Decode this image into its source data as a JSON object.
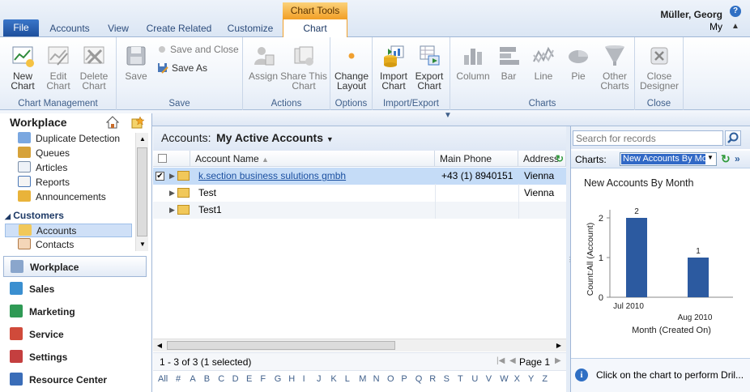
{
  "tabs": {
    "file": "File",
    "accounts": "Accounts",
    "view": "View",
    "create_related": "Create Related",
    "customize": "Customize",
    "chart_tools": "Chart Tools",
    "chart": "Chart"
  },
  "user": {
    "name": "Müller, Georg",
    "org": "My"
  },
  "ribbon": {
    "chart_management": {
      "label": "Chart Management",
      "new_chart": [
        "New",
        "Chart"
      ],
      "edit_chart": [
        "Edit",
        "Chart"
      ],
      "delete_chart": [
        "Delete",
        "Chart"
      ]
    },
    "save": {
      "label": "Save",
      "save": "Save",
      "save_close": "Save and Close",
      "save_as": "Save As"
    },
    "actions": {
      "label": "Actions",
      "assign": "Assign",
      "share": [
        "Share This",
        "Chart"
      ]
    },
    "options": {
      "label": "Options",
      "change_layout": [
        "Change",
        "Layout"
      ]
    },
    "import_export": {
      "label": "Import/Export",
      "import": [
        "Import",
        "Chart"
      ],
      "export": [
        "Export",
        "Chart"
      ]
    },
    "charts": {
      "label": "Charts",
      "column": "Column",
      "bar": "Bar",
      "line": "Line",
      "pie": "Pie",
      "other": [
        "Other",
        "Charts"
      ]
    },
    "close": {
      "label": "Close",
      "close_designer": [
        "Close",
        "Designer"
      ]
    }
  },
  "left": {
    "title": "Workplace",
    "items": [
      "Duplicate Detection",
      "Queues",
      "Articles",
      "Reports",
      "Announcements"
    ],
    "section": "Customers",
    "customers_items": [
      "Accounts",
      "Contacts"
    ],
    "buttons": [
      "Workplace",
      "Sales",
      "Marketing",
      "Service",
      "Settings",
      "Resource Center"
    ]
  },
  "grid": {
    "view_label": "Accounts:",
    "view_name": "My Active Accounts",
    "columns": [
      "Account Name",
      "Main Phone",
      "Address"
    ],
    "rows": [
      {
        "name": "k.section business sulutions gmbh",
        "phone": "+43 (1) 8940151",
        "city": "Vienna"
      },
      {
        "name": "Test",
        "phone": "",
        "city": "Vienna"
      },
      {
        "name": "Test1",
        "phone": "",
        "city": ""
      }
    ],
    "status": "1 - 3 of 3 (1 selected)",
    "page": "Page 1",
    "alpha": [
      "All",
      "#",
      "A",
      "B",
      "C",
      "D",
      "E",
      "F",
      "G",
      "H",
      "I",
      "J",
      "K",
      "L",
      "M",
      "N",
      "O",
      "P",
      "Q",
      "R",
      "S",
      "T",
      "U",
      "V",
      "W",
      "X",
      "Y",
      "Z"
    ]
  },
  "search": {
    "placeholder": "Search for records"
  },
  "chart_pane": {
    "charts_label": "Charts:",
    "selected_chart": "New Accounts By Month",
    "info": "Click on the chart to perform Dril..."
  },
  "chart_data": {
    "type": "bar",
    "title": "New Accounts By Month",
    "categories": [
      "Jul 2010",
      "Aug 2010"
    ],
    "values": [
      2,
      1
    ],
    "xlabel": "Month (Created On)",
    "ylabel": "Count:All (Account)",
    "ylim": [
      0,
      2
    ],
    "yticks": [
      0,
      1,
      2
    ],
    "bar_color": "#2c5aa0"
  }
}
